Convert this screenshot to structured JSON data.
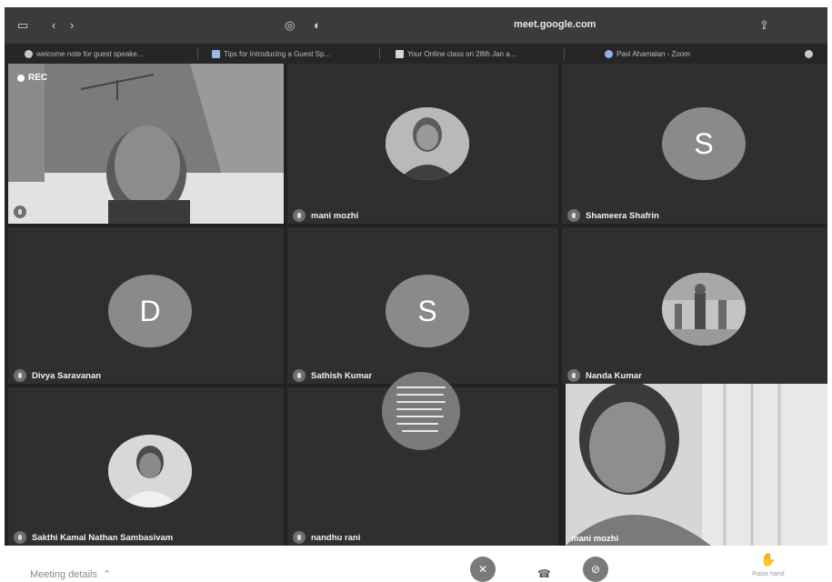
{
  "browser": {
    "url": "meet.google.com",
    "tabs": [
      {
        "label": "welcome note for guest speake...",
        "icon": "circle-icon"
      },
      {
        "label": "Tips for Introducing a Guest Sp...",
        "icon": "document-icon"
      },
      {
        "label": "Your Online class on 28th Jan a...",
        "icon": "gmail-icon"
      },
      {
        "label": "Pavi Ahamalan - Zoom",
        "icon": "zoom-icon"
      }
    ]
  },
  "recording": {
    "label": "REC"
  },
  "participants": [
    {
      "name": "",
      "type": "video"
    },
    {
      "name": "mani mozhi",
      "type": "photo"
    },
    {
      "name": "Shameera Shafrin",
      "type": "letter",
      "initial": "S"
    },
    {
      "name": "Divya Saravanan",
      "type": "letter",
      "initial": "D"
    },
    {
      "name": "Sathish Kumar",
      "type": "letter",
      "initial": "S"
    },
    {
      "name": "Nanda Kumar",
      "type": "photo"
    },
    {
      "name": "Sakthi Kamal Nathan Sambasivam",
      "type": "photo"
    },
    {
      "name": "nandhu rani",
      "type": "photo"
    },
    {
      "name": "mani mozhi",
      "type": "video"
    }
  ],
  "footer": {
    "meeting_details": "Meeting details",
    "raise_hand": "Raise hand"
  },
  "colors": {
    "tile_bg": "#2f2f2f",
    "avatar_gray": "#8a8a8a",
    "page_bg": "#ffffff"
  }
}
